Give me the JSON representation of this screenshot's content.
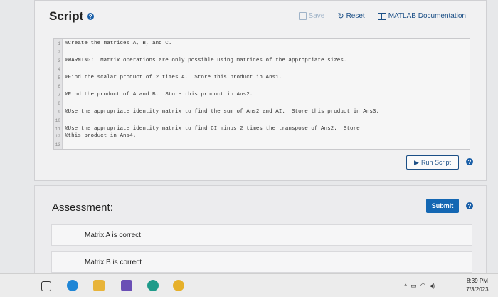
{
  "script": {
    "title": "Script",
    "save_label": "Save",
    "reset_label": "Reset",
    "doc_label": "MATLAB Documentation",
    "code_lines": [
      {
        "n": "1",
        "text": "%Create the matrices A, B, and C."
      },
      {
        "n": "2",
        "text": ""
      },
      {
        "n": "3",
        "text": "%WARNING:  Matrix operations are only possible using matrices of the appropriate sizes."
      },
      {
        "n": "4",
        "text": ""
      },
      {
        "n": "5",
        "text": "%Find the scalar product of 2 times A.  Store this product in Ans1."
      },
      {
        "n": "6",
        "text": ""
      },
      {
        "n": "7",
        "text": "%Find the product of A and B.  Store this product in Ans2."
      },
      {
        "n": "8",
        "text": ""
      },
      {
        "n": "9",
        "text": "%Use the appropriate identity matrix to find the sum of Ans2 and AI.  Store this product in Ans3."
      },
      {
        "n": "10",
        "text": ""
      },
      {
        "n": "11",
        "text": "%Use the appropriate identity matrix to find CI minus 2 times the transpose of Ans2.  Store"
      },
      {
        "n": "12",
        "text": "%this product in Ans4."
      },
      {
        "n": "13",
        "text": ""
      }
    ],
    "run_label": "Run Script"
  },
  "assessment": {
    "title": "Assessment:",
    "submit_label": "Submit",
    "tests": [
      "Matrix A is correct",
      "Matrix B is correct"
    ]
  },
  "taskbar": {
    "time": "8:39 PM",
    "date": "7/3/2023"
  },
  "icons": {
    "help": "help-icon",
    "save": "save-icon",
    "reset": "reset-icon",
    "doc": "matlab-doc-icon",
    "run": "play-icon"
  },
  "colors": {
    "accent": "#1467b3",
    "link": "#1b4f86"
  }
}
